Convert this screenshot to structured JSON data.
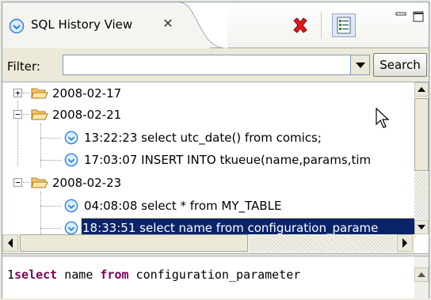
{
  "view": {
    "tab_title": "SQL History View",
    "tab_close_glyph": "✕",
    "toolbar": {
      "remove_icon": "red-x-icon",
      "layout_icon": "layout-toggle-icon"
    }
  },
  "filter": {
    "label": "Filter:",
    "value": "",
    "search_label": "Search"
  },
  "tree": {
    "groups": [
      {
        "date": "2008-02-17",
        "expanded": false,
        "expander": "+",
        "items": []
      },
      {
        "date": "2008-02-21",
        "expanded": true,
        "expander": "−",
        "items": [
          {
            "time": "13:22:23",
            "query": "select utc_date() from comics;"
          },
          {
            "time": "17:03:07",
            "query": "INSERT INTO tkueue(name,params,tim"
          }
        ]
      },
      {
        "date": "2008-02-23",
        "expanded": true,
        "expander": "−",
        "items": [
          {
            "time": "04:08:08",
            "query": "select * from MY_TABLE"
          },
          {
            "time": "18:33:51",
            "query": "select name from configuration_parame",
            "selected": true
          }
        ]
      }
    ]
  },
  "editor": {
    "line_number": "1",
    "tokens": [
      {
        "text": "select",
        "kw": true
      },
      {
        "text": " name ",
        "kw": false
      },
      {
        "text": "from",
        "kw": true
      },
      {
        "text": " configuration_parameter",
        "kw": false
      }
    ]
  },
  "colors": {
    "selection": "#0a246a",
    "keyword": "#7f0055",
    "accent_blue": "#3a8fde"
  }
}
